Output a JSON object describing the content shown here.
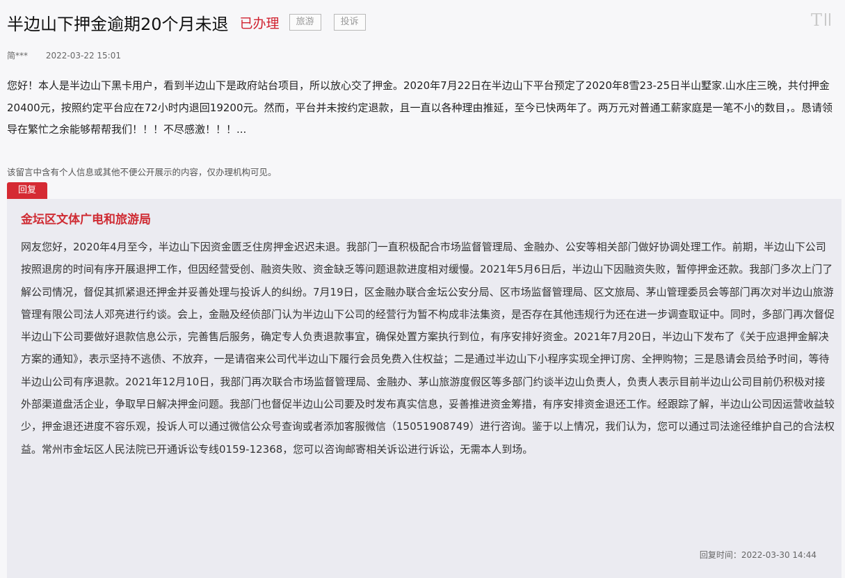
{
  "post": {
    "title": "半边山下押金逾期20个月未退",
    "status": "已办理",
    "tags": [
      "旅游",
      "投诉"
    ],
    "author": "简***",
    "date": "2022-03-22 15:01",
    "content": "您好！本人是半边山下黑卡用户，看到半边山下是政府站台项目，所以放心交了押金。2020年7月22日在半边山下平台预定了2020年8雪23-25日半山墅家.山水庄三晚，共付押金20400元，按照约定平台应在72小时内退回19200元。然而，平台并未按约定退款，且一直以各种理由推延，至今已快两年了。两万元对普通工薪家庭是一笔不小的数目，。恳请领导在繁忙之余能够帮帮我们！！！不尽感激！！！...",
    "privacy_note": "该留言中含有个人信息或其他不便公开展示的内容，仅办理机构可见。",
    "font_toggle_icon": "font-size-toggle-icon"
  },
  "reply": {
    "tab_label": "回复",
    "department": "金坛区文体广电和旅游局",
    "content": "网友您好，2020年4月至今，半边山下因资金匮乏住房押金迟迟未退。我部门一直积极配合市场监督管理局、金融办、公安等相关部门做好协调处理工作。前期，半边山下公司按照退房的时间有序开展退押工作，但因经营受创、融资失败、资金缺乏等问题退款进度相对缓慢。2021年5月6日后，半边山下因融资失败，暂停押金还款。我部门多次上门了解公司情况，督促其抓紧退还押金并妥善处理与投诉人的纠纷。7月19日，区金融办联合金坛公安分局、区市场监督管理局、区文旅局、茅山管理委员会等部门再次对半边山旅游管理有限公司法人邓亮进行约谈。会上，金融及经侦部门认为半边山下公司的经营行为暂不构成非法集资，是否存在其他违规行为还在进一步调查取证中。同时，多部门再次督促半边山下公司要做好退款信息公示，完善售后服务，确定专人负责退款事宜，确保处置方案执行到位，有序安排好资金。2021年7月20日，半边山下发布了《关于应退押金解决方案的通知》，表示坚持不逃债、不放弃，一是请宿来公司代半边山下履行会员免费入住权益；二是通过半边山下小程序实现全押订房、全押购物；三是恳请会员给予时间，等待半边山公司有序退款。2021年12月10日，我部门再次联合市场监督管理局、金融办、茅山旅游度假区等多部门约谈半边山负责人，负责人表示目前半边山公司目前仍积极对接外部渠道盘活企业，争取早日解决押金问题。我部门也督促半边山公司要及时发布真实信息，妥善推进资金筹措，有序安排资金退还工作。经跟踪了解，半边山公司因运营收益较少，押金退还进度不容乐观，投诉人可以通过微信公众号查询或者添加客服微信（15051908749）进行咨询。鉴于以上情况，我们认为，您可以通过司法途径维护自己的合法权益。常州市金坛区人民法院已开通诉讼专线0159-12368，您可以咨询邮寄相关诉讼进行诉讼，无需本人到场。",
    "time_label": "回复时间：",
    "time": "2022-03-30 14:44"
  },
  "colors": {
    "accent": "#d0212f",
    "reply_background": "#ebebf1",
    "page_background": "#f7f7f9"
  }
}
